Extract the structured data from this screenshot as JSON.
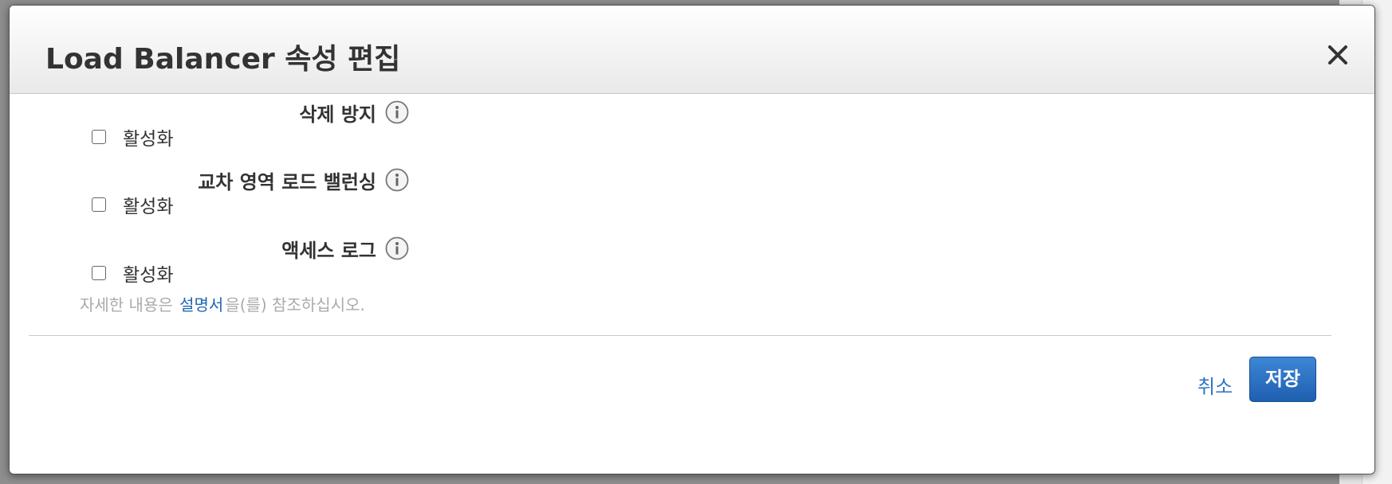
{
  "dialog": {
    "title": "Load Balancer 속성 편집"
  },
  "sections": [
    {
      "label": "삭제 방지",
      "checkbox_label": "활성화",
      "checked": false
    },
    {
      "label": "교차 영역 로드 밸런싱",
      "checkbox_label": "활성화",
      "checked": false
    },
    {
      "label": "액세스 로그",
      "checkbox_label": "활성화",
      "checked": false
    }
  ],
  "help": {
    "prefix": "자세한 내용은",
    "link": "설명서",
    "suffix": "을(를) 참조하십시오."
  },
  "footer": {
    "cancel_label": "취소",
    "save_label": "저장"
  },
  "icons": {
    "close": "close-icon",
    "info": "info-icon"
  },
  "colors": {
    "link": "#1f67b5",
    "primary_button": "#2a6fc4"
  }
}
